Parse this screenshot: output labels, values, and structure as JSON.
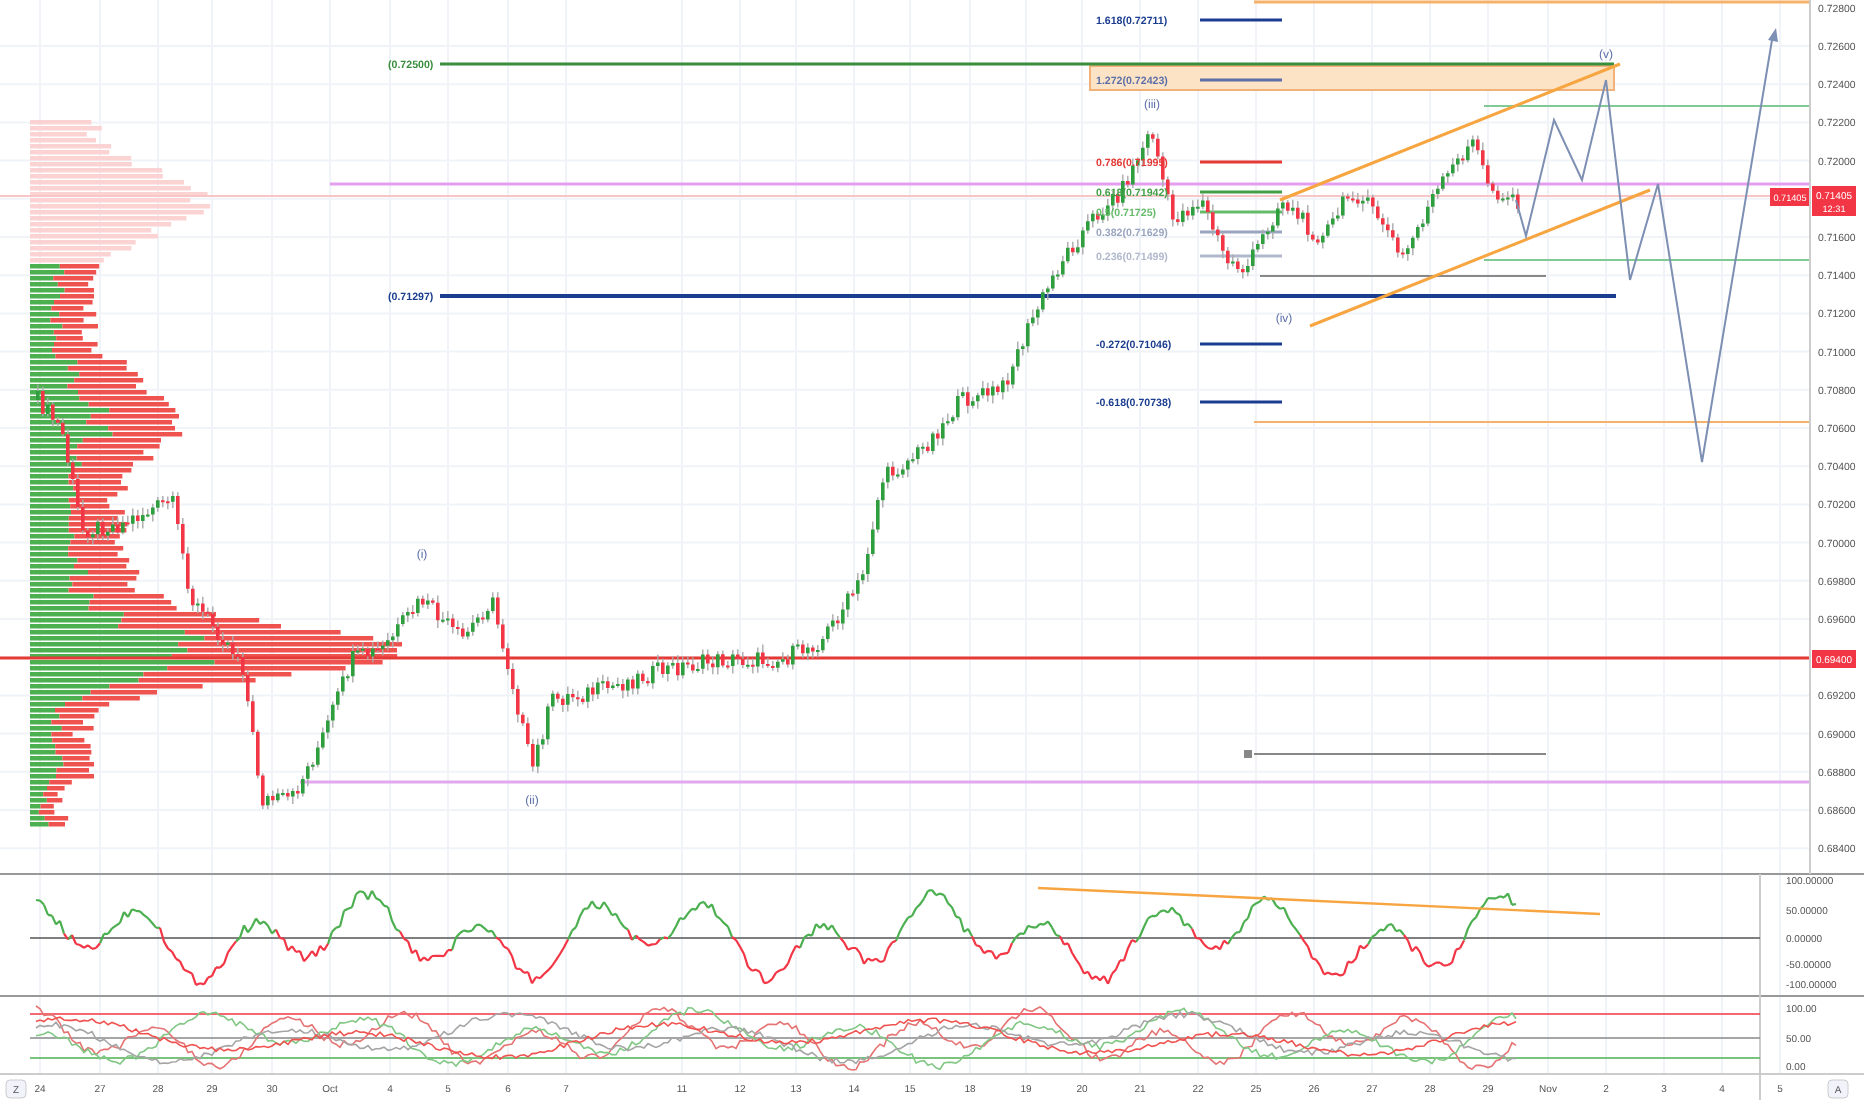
{
  "price_axis": {
    "labels": [
      "0.72800",
      "0.72600",
      "0.72400",
      "0.72200",
      "0.72000",
      "0.71600",
      "0.71400",
      "0.71200",
      "0.71000",
      "0.70800",
      "0.70600",
      "0.70400",
      "0.70200",
      "0.70000",
      "0.69800",
      "0.69600",
      "0.69200",
      "0.69000",
      "0.68800",
      "0.68600",
      "0.68400"
    ]
  },
  "last_price": {
    "value": "0.71405",
    "countdown": "12:31"
  },
  "chart_tag": "0.71405",
  "poc_tag": "0.69400",
  "fib_labels": [
    {
      "text": "1.618(0.72711)",
      "color": "#1a3d8f"
    },
    {
      "text": "1.272(0.72423)",
      "color": "#5b6fa8"
    },
    {
      "text": "0.786(0.71995)",
      "color": "#e53935"
    },
    {
      "text": "0.618(0.71942)",
      "color": "#43a047"
    },
    {
      "text": "0.5(0.71725)",
      "color": "#66bb6a"
    },
    {
      "text": "0.382(0.71629)",
      "color": "#9aa5c0"
    },
    {
      "text": "0.236(0.71499)",
      "color": "#b0b8cc"
    },
    {
      "text": "-0.272(0.71046)",
      "color": "#1a3d8f"
    },
    {
      "text": "-0.618(0.70738)",
      "color": "#1a3d8f"
    }
  ],
  "level_labels": [
    {
      "text": "(0.72500)",
      "color": "#388e3c"
    },
    {
      "text": "(0.71297)",
      "color": "#1a3d8f"
    }
  ],
  "wave_labels": [
    "(iii)",
    "(iv)",
    "(v)",
    "(i)",
    "(ii)"
  ],
  "oscillator_1": {
    "labels": [
      "100.00000",
      "50.00000",
      "0.00000",
      "-50.00000",
      "-100.00000"
    ]
  },
  "oscillator_2": {
    "labels": [
      "100.00",
      "50.00",
      "0.00"
    ]
  },
  "time_axis": {
    "labels": [
      "24",
      "27",
      "28",
      "29",
      "30",
      "Oct",
      "4",
      "5",
      "6",
      "7",
      "11",
      "12",
      "13",
      "14",
      "15",
      "18",
      "19",
      "20",
      "21",
      "22",
      "25",
      "26",
      "27",
      "28",
      "29",
      "Nov",
      "2",
      "3",
      "4",
      "5"
    ]
  },
  "corner_buttons": [
    "Z",
    "A"
  ]
}
